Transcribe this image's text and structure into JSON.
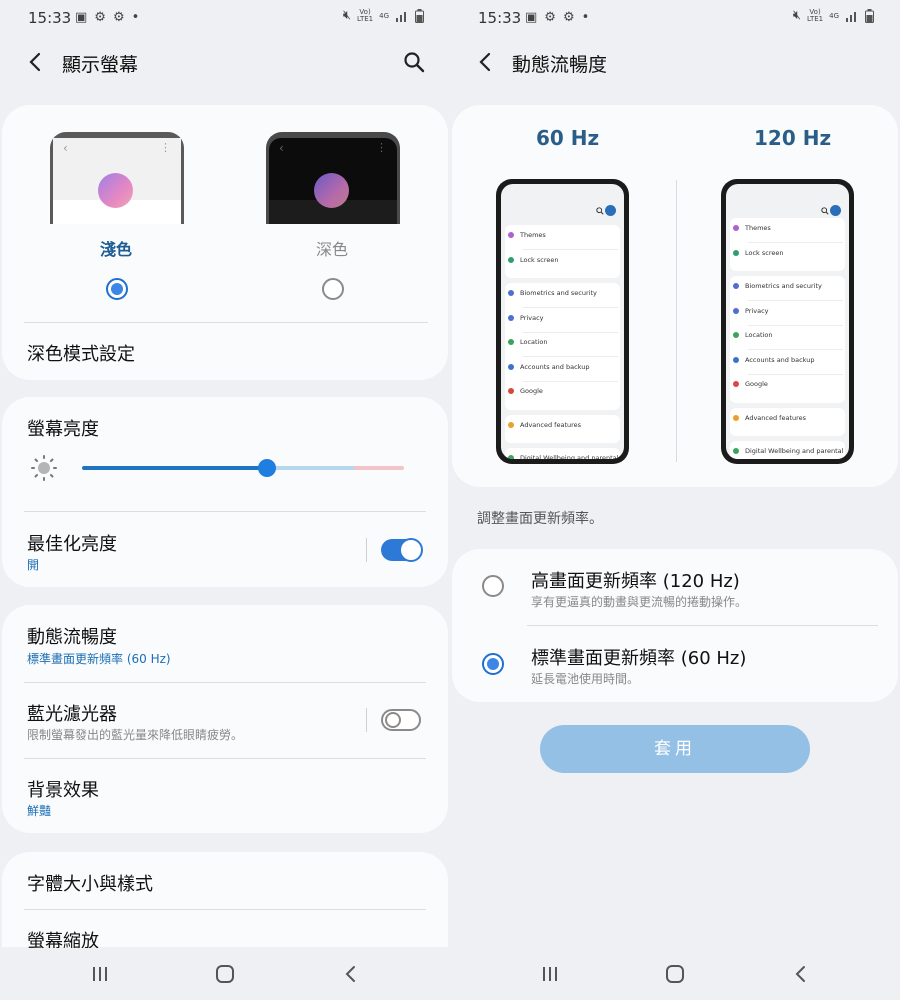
{
  "status": {
    "time": "15:33",
    "net1": "Vo)",
    "net2": "LTE1",
    "net3": "4G"
  },
  "left": {
    "title": "顯示螢幕",
    "theme": {
      "light_label": "淺色",
      "dark_label": "深色"
    },
    "dark_mode_settings": "深色模式設定",
    "brightness": {
      "title": "螢幕亮度",
      "level": 0.58
    },
    "adaptive": {
      "title": "最佳化亮度",
      "status": "開"
    },
    "motion": {
      "title": "動態流暢度",
      "status": "標準畫面更新頻率 (60 Hz)"
    },
    "blue_light": {
      "title": "藍光濾光器",
      "desc": "限制螢幕發出的藍光量來降低眼睛疲勞。"
    },
    "background": {
      "title": "背景效果",
      "status": "鮮豔"
    },
    "font": {
      "title": "字體大小與樣式"
    },
    "zoom": {
      "title": "螢幕縮放"
    }
  },
  "right": {
    "title": "動態流暢度",
    "hz60": "60 Hz",
    "hz120": "120 Hz",
    "mock_left": [
      "Themes",
      "Lock screen",
      "Biometrics and security",
      "Privacy",
      "Location",
      "Accounts and backup",
      "Google",
      "Advanced features",
      "Digital Wellbeing and parental"
    ],
    "mock_right": [
      "Themes",
      "Lock screen",
      "Biometrics and security",
      "Privacy",
      "Location",
      "Accounts and backup",
      "Google",
      "Advanced features",
      "Digital Wellbeing and parental"
    ],
    "section_label": "調整畫面更新頻率。",
    "option_high": {
      "title": "高畫面更新頻率 (120 Hz)",
      "desc": "享有更逼真的動畫與更流暢的捲動操作。"
    },
    "option_std": {
      "title": "標準畫面更新頻率 (60 Hz)",
      "desc": "延長電池使用時間。"
    },
    "apply": "套用"
  },
  "colors": {
    "accent": "#1d6fd0",
    "link_blue": "#1b6fb5",
    "apply_disabled": "#94c0e6",
    "hz_text": "#2a5e88"
  }
}
